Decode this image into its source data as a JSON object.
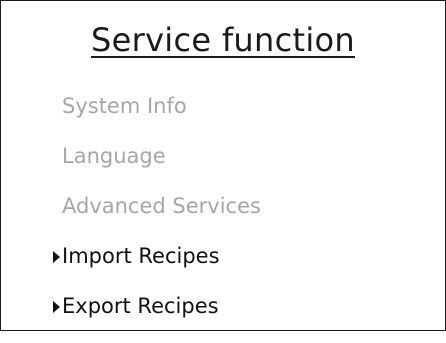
{
  "screen": {
    "title": "Service function"
  },
  "menu": {
    "items": [
      {
        "label": "System Info",
        "state": "disabled"
      },
      {
        "label": "Language",
        "state": "disabled"
      },
      {
        "label": "Advanced Services",
        "state": "disabled"
      },
      {
        "label": "Import Recipes",
        "state": "enabled",
        "icon": "triangle-right-icon"
      },
      {
        "label": "Export Recipes",
        "state": "enabled",
        "icon": "triangle-right-icon"
      }
    ]
  },
  "colors": {
    "disabled_text": "#a6a6a6",
    "enabled_text": "#111111",
    "border": "#1a1a1a",
    "background": "#ffffff"
  }
}
